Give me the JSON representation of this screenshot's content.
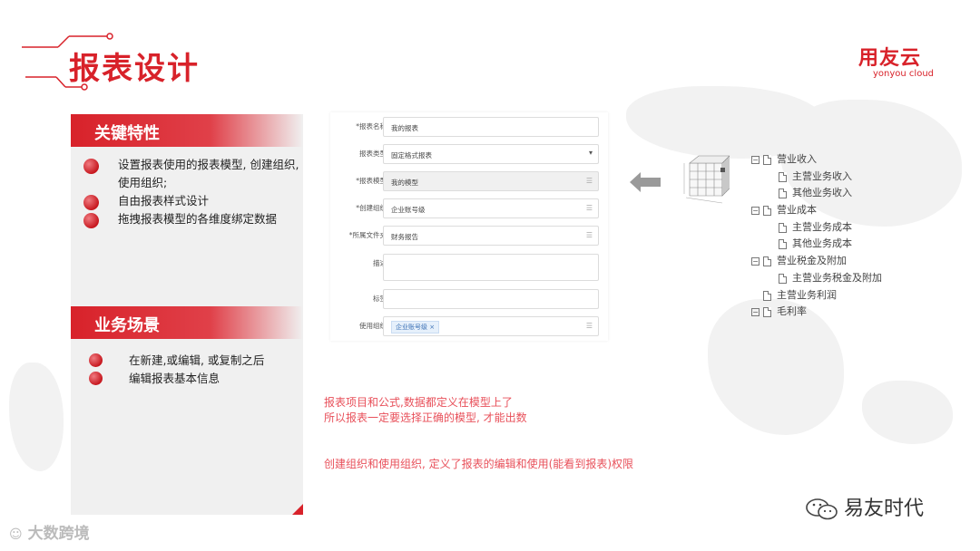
{
  "title": "报表设计",
  "logo": {
    "cn": "用友云",
    "en": "yonyou cloud"
  },
  "features": {
    "header": "关键特性",
    "items": [
      "设置报表使用的报表模型, 创建组织, 使用组织;",
      "自由报表样式设计",
      "拖拽报表模型的各维度绑定数据"
    ]
  },
  "scenarios": {
    "header": "业务场景",
    "items": [
      "在新建,或编辑, 或复制之后",
      "编辑报表基本信息"
    ]
  },
  "form": {
    "rows": [
      {
        "label": "*报表名称",
        "value": "我的报表"
      },
      {
        "label": "报表类型",
        "value": "固定格式报表"
      },
      {
        "label": "*报表模型",
        "value": "我的模型"
      },
      {
        "label": "*创建组织",
        "value": "企业账号级"
      },
      {
        "label": "*所属文件夹",
        "value": "财务报告"
      },
      {
        "label": "描述",
        "value": ""
      },
      {
        "label": "标签",
        "value": ""
      },
      {
        "label": "使用组织",
        "value": "企业账号级"
      }
    ]
  },
  "tree": {
    "nodes": [
      {
        "label": "营业收入",
        "level": 0,
        "expand": true
      },
      {
        "label": "主营业务收入",
        "level": 1
      },
      {
        "label": "其他业务收入",
        "level": 1
      },
      {
        "label": "营业成本",
        "level": 0,
        "expand": true
      },
      {
        "label": "主营业务成本",
        "level": 1
      },
      {
        "label": "其他业务成本",
        "level": 1
      },
      {
        "label": "营业税金及附加",
        "level": 0,
        "expand": true
      },
      {
        "label": "主营业务税金及附加",
        "level": 1
      },
      {
        "label": "主营业务利润",
        "level": 0,
        "expand": false
      },
      {
        "label": "毛利率",
        "level": 0,
        "expand": true
      }
    ]
  },
  "notes": {
    "line1": "报表项目和公式,数据都定义在模型上了",
    "line2": "所以报表一定要选择正确的模型, 才能出数",
    "line3": "创建组织和使用组织, 定义了报表的编辑和使用(能看到报表)权限"
  },
  "watermark_left": "大数跨境",
  "watermark_right": "易友时代",
  "colors": {
    "brand_red": "#d8222a",
    "note_red": "#e8505a"
  }
}
